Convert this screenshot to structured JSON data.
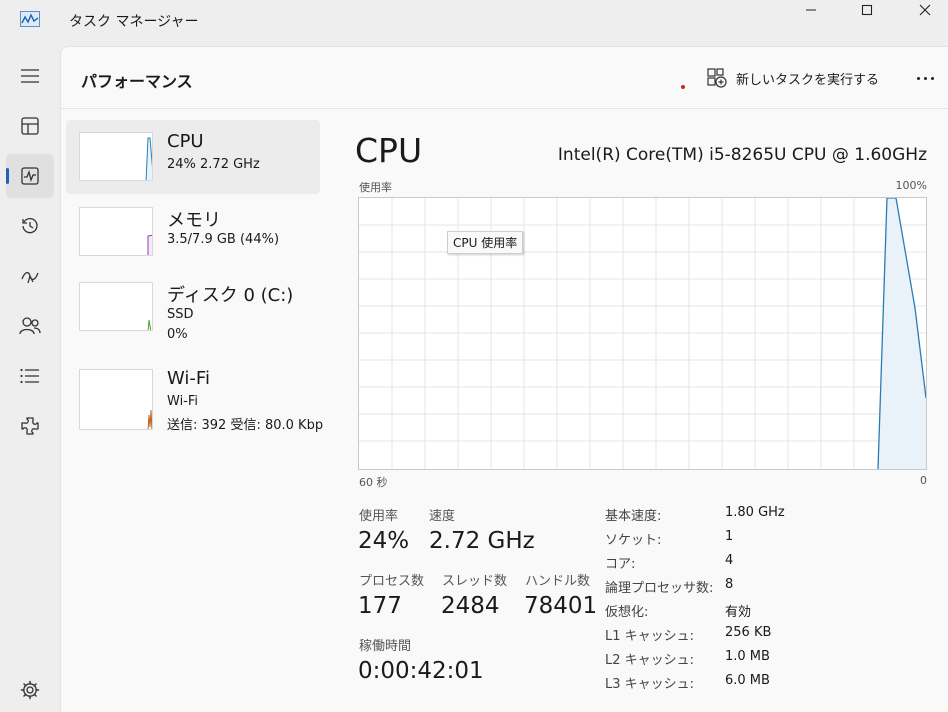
{
  "window": {
    "title": "タスク マネージャー"
  },
  "header": {
    "page_title": "パフォーマンス",
    "new_task_label": "新しいタスクを実行する"
  },
  "nav": {
    "items": [
      {
        "icon": "processes-icon"
      },
      {
        "icon": "performance-icon"
      },
      {
        "icon": "app-history-icon"
      },
      {
        "icon": "startup-apps-icon"
      },
      {
        "icon": "users-icon"
      },
      {
        "icon": "details-icon"
      },
      {
        "icon": "services-icon"
      }
    ],
    "settings_icon": "settings-gear-icon"
  },
  "devices": [
    {
      "name": "CPU",
      "line1": "24%  2.72 GHz",
      "line2": "",
      "color": "#2b7cb5"
    },
    {
      "name": "メモリ",
      "line1": "3.5/7.9 GB (44%)",
      "line2": "",
      "color": "#8d3fb3"
    },
    {
      "name": "ディスク 0 (C:)",
      "line1": "SSD",
      "line2": "0%",
      "color": "#4ea12f"
    },
    {
      "name": "Wi-Fi",
      "line1": "Wi-Fi",
      "line2": "送信: 392  受信: 80.0 Kbps",
      "color": "#c25f1a"
    }
  ],
  "detail": {
    "title": "CPU",
    "model": "Intel(R) Core(TM) i5-8265U CPU @ 1.60GHz",
    "graph_label_top_left": "使用率",
    "graph_label_top_right": "100%",
    "graph_label_bottom_left": "60 秒",
    "graph_label_bottom_right": "0",
    "tooltip": "CPU 使用率",
    "stats": {
      "usage_label": "使用率",
      "usage_value": "24%",
      "speed_label": "速度",
      "speed_value": "2.72 GHz",
      "process_label": "プロセス数",
      "process_value": "177",
      "thread_label": "スレッド数",
      "thread_value": "2484",
      "handle_label": "ハンドル数",
      "handle_value": "78401",
      "uptime_label": "稼働時間",
      "uptime_value": "0:00:42:01"
    },
    "specs": [
      {
        "key": "基本速度:",
        "value": "1.80 GHz"
      },
      {
        "key": "ソケット:",
        "value": "1"
      },
      {
        "key": "コア:",
        "value": "4"
      },
      {
        "key": "論理プロセッサ数:",
        "value": "8"
      },
      {
        "key": "仮想化:",
        "value": "有効"
      },
      {
        "key": "L1 キャッシュ:",
        "value": "256 KB"
      },
      {
        "key": "L2 キャッシュ:",
        "value": "1.0 MB"
      },
      {
        "key": "L3 キャッシュ:",
        "value": "6.0 MB"
      }
    ]
  },
  "colors": {
    "accent": "#1e63b5",
    "cpu_line": "#2b7cb5",
    "cpu_fill": "#eaf2f9"
  }
}
